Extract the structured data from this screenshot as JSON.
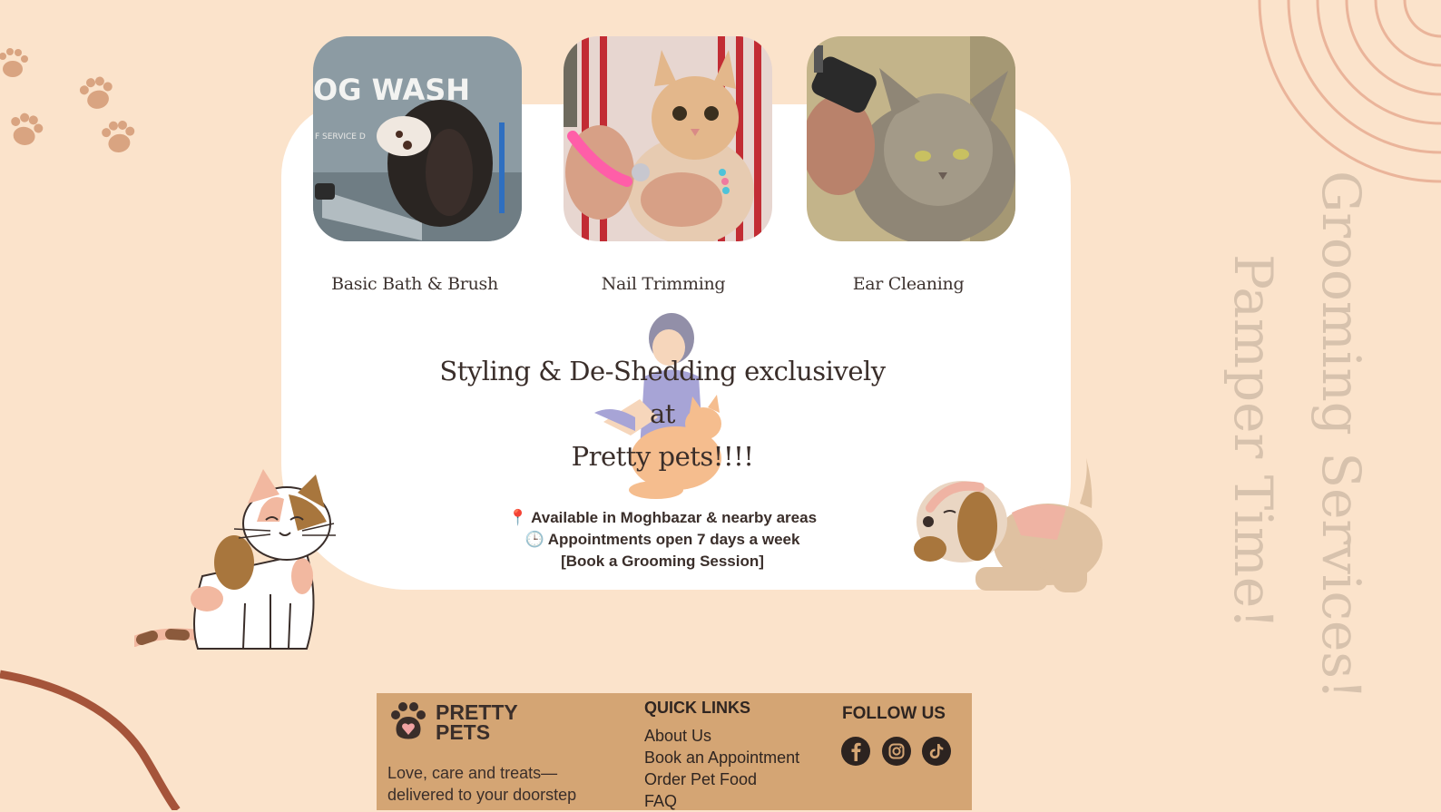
{
  "services": [
    {
      "label": "Basic Bath & Brush",
      "photo": "dog-wash-photo",
      "photo_text": "OG WASH",
      "photo_subtext": "F SERVICE D"
    },
    {
      "label": "Nail Trimming",
      "photo": "cat-nail-trim-photo"
    },
    {
      "label": "Ear Cleaning",
      "photo": "cat-ear-clean-photo"
    }
  ],
  "headline": {
    "line1": "Styling & De-Shedding exclusively",
    "line2": "at",
    "line3": "Pretty pets!!!!"
  },
  "info": {
    "location_icon": "📍",
    "location": "Available in Moghbazar & nearby areas",
    "clock_icon": "🕒",
    "hours": "Appointments open 7 days a week",
    "cta": "[Book a Grooming Session]"
  },
  "vertical_text": {
    "line1": "Grooming Services!",
    "line2": "Pamper Time!"
  },
  "footer": {
    "brand_line1": "PRETTY",
    "brand_line2": "PETS",
    "tagline_line1": "Love, care and treats—",
    "tagline_line2": "delivered to your doorstep",
    "quick_links_title": "QUICK LINKS",
    "quick_links": [
      "About Us",
      "Book an Appointment",
      "Order Pet Food",
      "FAQ"
    ],
    "follow_title": "FOLLOW US",
    "social": [
      "facebook-icon",
      "instagram-icon",
      "tiktok-icon"
    ]
  },
  "colors": {
    "background": "#fbe3cb",
    "card": "#ffffff",
    "footer": "#d4a574",
    "accent_brown": "#a5543a",
    "paw": "#d9a481"
  }
}
